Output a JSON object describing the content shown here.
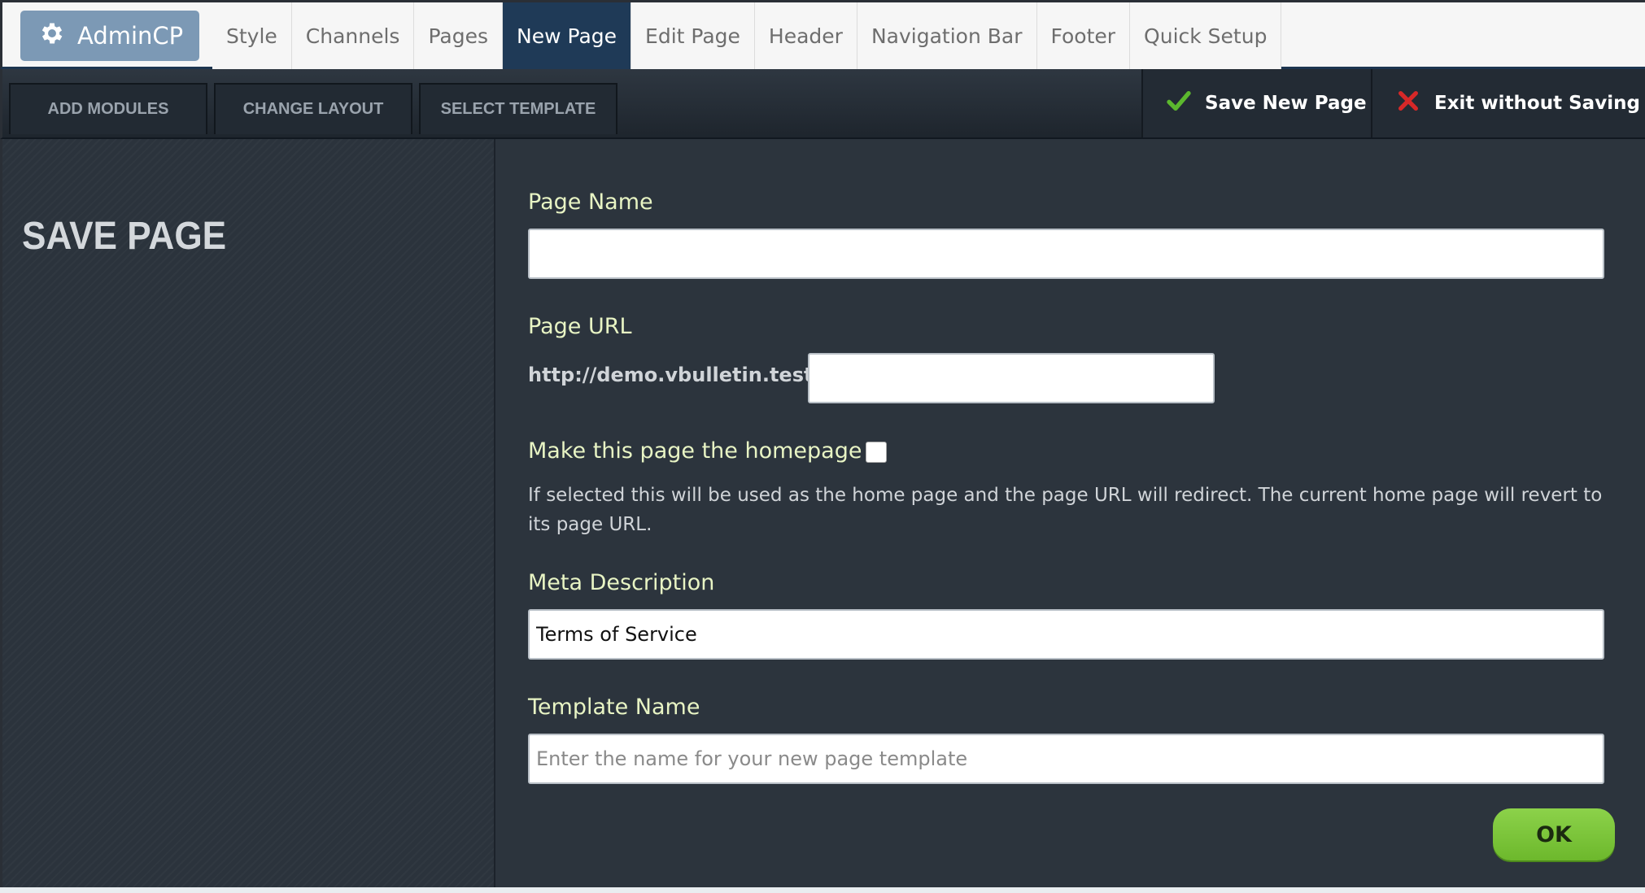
{
  "topbar": {
    "admin_label": "AdminCP",
    "tabs": [
      {
        "label": "Style"
      },
      {
        "label": "Channels"
      },
      {
        "label": "Pages"
      },
      {
        "label": "New Page"
      },
      {
        "label": "Edit Page"
      },
      {
        "label": "Header"
      },
      {
        "label": "Navigation Bar"
      },
      {
        "label": "Footer"
      },
      {
        "label": "Quick Setup"
      }
    ],
    "active_tab": "New Page"
  },
  "toolbar": {
    "add_modules": "ADD MODULES",
    "change_layout": "CHANGE LAYOUT",
    "select_template": "SELECT TEMPLATE",
    "save_new_page": "Save New Page",
    "exit_without_saving": "Exit without Saving"
  },
  "sidebar": {
    "title": "SAVE PAGE"
  },
  "form": {
    "page_name": {
      "label": "Page Name",
      "value": ""
    },
    "page_url": {
      "label": "Page URL",
      "prefix": "http://demo.vbulletin.test/",
      "value": ""
    },
    "homepage": {
      "label": "Make this page the homepage",
      "checked": false,
      "help": "If selected this will be used as the home page and the page URL will redirect. The current home page will revert to its page URL."
    },
    "meta_description": {
      "label": "Meta Description",
      "value": "Terms of Service"
    },
    "template_name": {
      "label": "Template Name",
      "value": "",
      "placeholder": "Enter the name for your new page template"
    },
    "ok_label": "OK"
  },
  "colors": {
    "active_tab": "#1f3a57",
    "label": "#e8f4c4",
    "ok_button": "#7cc63a",
    "check": "#5cb82e",
    "cross": "#d62828"
  }
}
